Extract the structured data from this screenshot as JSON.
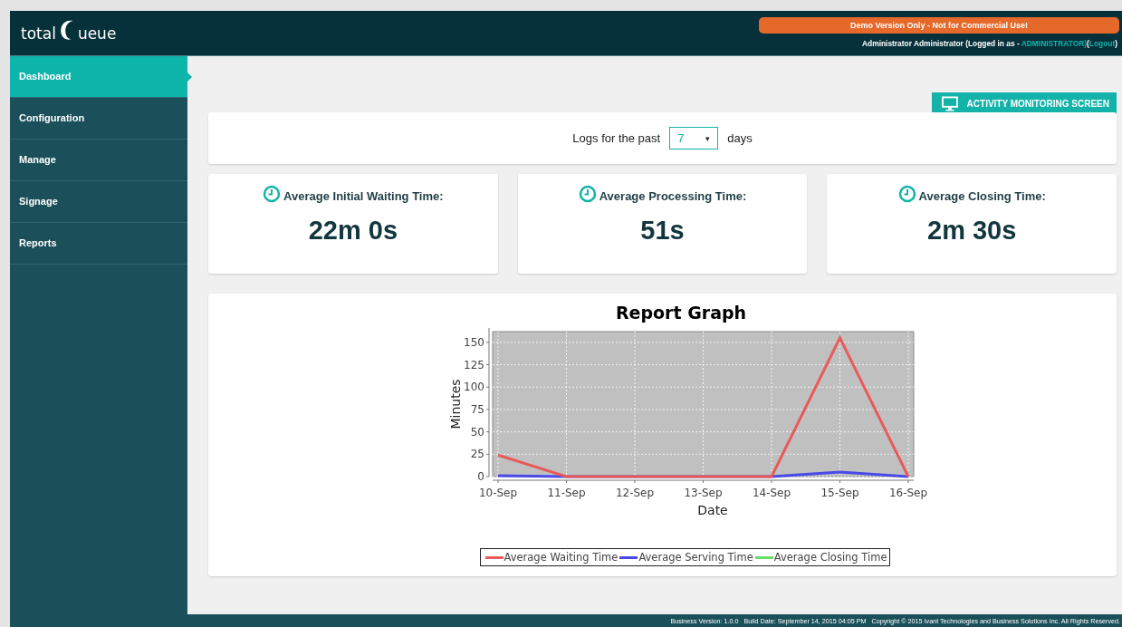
{
  "header": {
    "logo_left": "total",
    "logo_right": "ueue",
    "demo_banner": "Demo Version Only - Not for Commercial Use!",
    "user_text": "Administrator Administrator (Logged in as - ",
    "user_role": "ADMINISTRATOR)",
    "logout_open": "(",
    "logout": "Logout",
    "logout_close": ")"
  },
  "sidebar": {
    "items": [
      {
        "label": "Dashboard",
        "selected": true
      },
      {
        "label": "Configuration",
        "selected": false
      },
      {
        "label": "Manage",
        "selected": false
      },
      {
        "label": "Signage",
        "selected": false
      },
      {
        "label": "Reports",
        "selected": false
      }
    ]
  },
  "activity_button": "ACTIVITY MONITORING SCREEN",
  "filter": {
    "prefix": "Logs for the past",
    "value": "7",
    "caret": "▾",
    "suffix": "days"
  },
  "stats": [
    {
      "label": "Average Initial Waiting Time:",
      "value": "22m 0s"
    },
    {
      "label": "Average Processing Time:",
      "value": "51s"
    },
    {
      "label": "Average Closing Time:",
      "value": "2m 30s"
    }
  ],
  "report": {
    "chart_data": {
      "type": "line",
      "grid": true,
      "legend": true,
      "title": "Report Graph",
      "xlabel": "Date",
      "ylabel": "Minutes",
      "categories": [
        "10-Sep",
        "11-Sep",
        "12-Sep",
        "13-Sep",
        "14-Sep",
        "15-Sep",
        "16-Sep"
      ],
      "ylim": [
        0,
        162
      ],
      "yticks": [
        0,
        25,
        50,
        75,
        100,
        125,
        150
      ],
      "series": [
        {
          "name": "Average Waiting Time",
          "color": "#e85a5a",
          "values": [
            24,
            0,
            0,
            0,
            0,
            155,
            0
          ]
        },
        {
          "name": "Average Serving Time",
          "color": "#4a4ae8",
          "values": [
            1,
            0,
            0,
            0,
            0,
            5,
            0
          ]
        },
        {
          "name": "Average Closing Time",
          "color": "#66e066",
          "values": [
            null,
            null,
            null,
            null,
            null,
            null,
            null
          ]
        }
      ]
    }
  },
  "footer": "Business Version: 1.0.0   Build Date: September 14, 2015 04:05 PM   Copyright © 2015 Ivant Technologies and Business Solutions Inc. All Rights Reserved."
}
